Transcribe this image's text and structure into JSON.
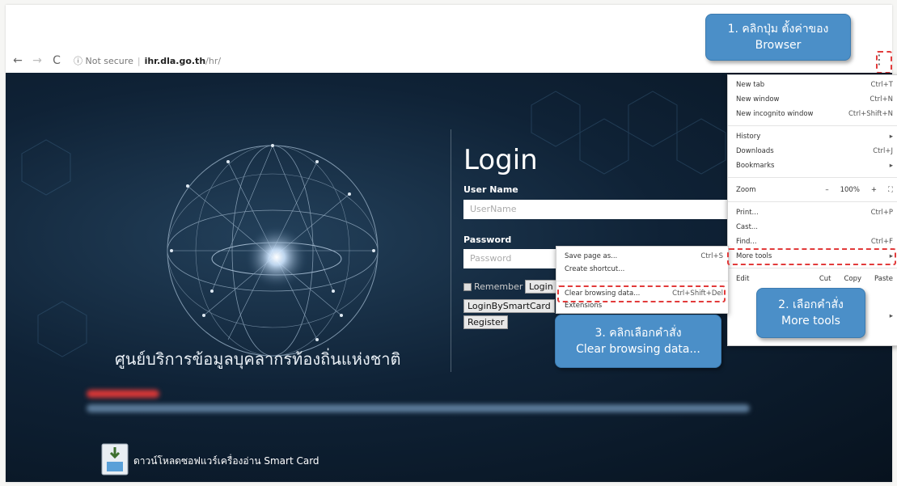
{
  "browser": {
    "back_icon": "arrow-left-icon",
    "forward_icon": "arrow-right-icon",
    "reload_icon": "reload-icon",
    "info_label": "ⓘ Not secure",
    "url_host": "ihr.dla.go.th",
    "url_path": "/hr/"
  },
  "page": {
    "tagline": "ศูนย์บริการข้อมูลบุคลากรท้องถิ่นแห่งชาติ",
    "login_title": "Login",
    "username_label": "User Name",
    "username_placeholder": "UserName",
    "password_label": "Password",
    "password_placeholder": "Password",
    "remember_label": "Remember",
    "login_button": "Login",
    "smartcard_button": "LoginBySmartCard",
    "register_button": "Register",
    "smartcard_download_label": "ดาวน์โหลดซอฟแวร์เครื่องอ่าน Smart Card"
  },
  "chrome_menu": {
    "new_tab": {
      "label": "New tab",
      "shortcut": "Ctrl+T"
    },
    "new_window": {
      "label": "New window",
      "shortcut": "Ctrl+N"
    },
    "new_incognito": {
      "label": "New incognito window",
      "shortcut": "Ctrl+Shift+N"
    },
    "history": {
      "label": "History",
      "shortcut": "▸"
    },
    "downloads": {
      "label": "Downloads",
      "shortcut": "Ctrl+J"
    },
    "bookmarks": {
      "label": "Bookmarks",
      "shortcut": "▸"
    },
    "zoom": {
      "label": "Zoom",
      "minus": "–",
      "value": "100%",
      "plus": "+",
      "fullscreen": "⛶"
    },
    "print": {
      "label": "Print...",
      "shortcut": "Ctrl+P"
    },
    "cast": {
      "label": "Cast..."
    },
    "find": {
      "label": "Find...",
      "shortcut": "Ctrl+F"
    },
    "more_tools": {
      "label": "More tools",
      "shortcut": "▸"
    },
    "edit": {
      "label": "Edit",
      "cut": "Cut",
      "copy": "Copy",
      "paste": "Paste"
    },
    "settings_arrow": "▸"
  },
  "submenu": {
    "save_page": {
      "label": "Save page as...",
      "shortcut": "Ctrl+S"
    },
    "create_shortcut": {
      "label": "Create shortcut..."
    },
    "clear_browsing": {
      "label": "Clear browsing data...",
      "shortcut": "Ctrl+Shift+Del"
    },
    "extensions": {
      "label": "Extensions"
    }
  },
  "callouts": {
    "step1_line1": "1. คลิกปุ่ม ตั้งค่าของ",
    "step1_line2": "Browser",
    "step2_line1": "2. เลือกคำสั่ง",
    "step2_line2": "More tools",
    "step3_line1": "3. คลิกเลือกคำสั่ง",
    "step3_line2": "Clear browsing data..."
  },
  "colors": {
    "callout_blue": "#4b8fc8",
    "highlight_red": "#e23b3b",
    "page_dark": "#0f2236"
  }
}
